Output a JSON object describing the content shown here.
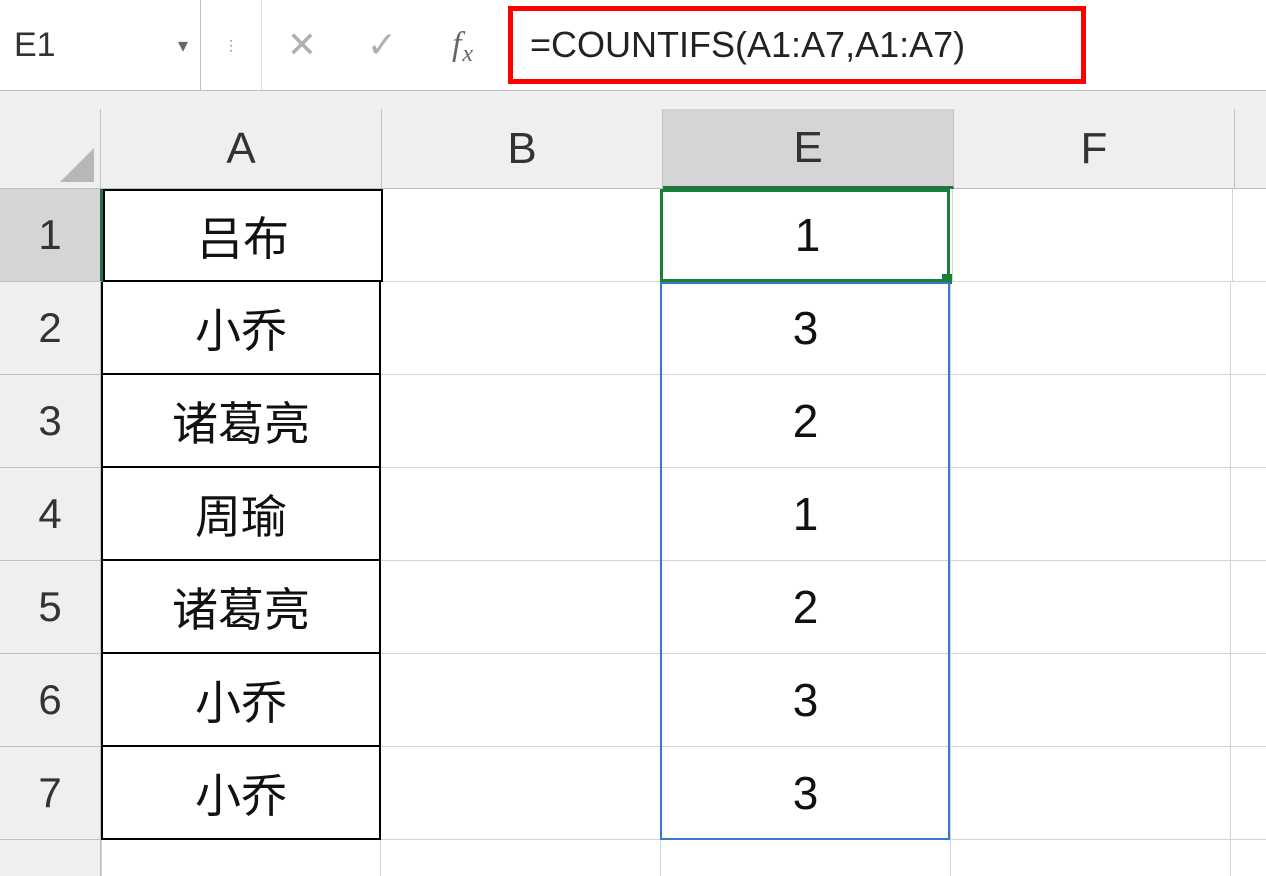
{
  "formula_bar": {
    "name_box": "E1",
    "formula": "=COUNTIFS(A1:A7,A1:A7)"
  },
  "columns": [
    "A",
    "B",
    "E",
    "F"
  ],
  "selected_column": "E",
  "selected_row": "1",
  "rows": [
    {
      "num": "1",
      "A": "吕布",
      "E": "1"
    },
    {
      "num": "2",
      "A": "小乔",
      "E": "3"
    },
    {
      "num": "3",
      "A": "诸葛亮",
      "E": "2"
    },
    {
      "num": "4",
      "A": "周瑜",
      "E": "1"
    },
    {
      "num": "5",
      "A": "诸葛亮",
      "E": "2"
    },
    {
      "num": "6",
      "A": "小乔",
      "E": "3"
    },
    {
      "num": "7",
      "A": "小乔",
      "E": "3"
    }
  ]
}
